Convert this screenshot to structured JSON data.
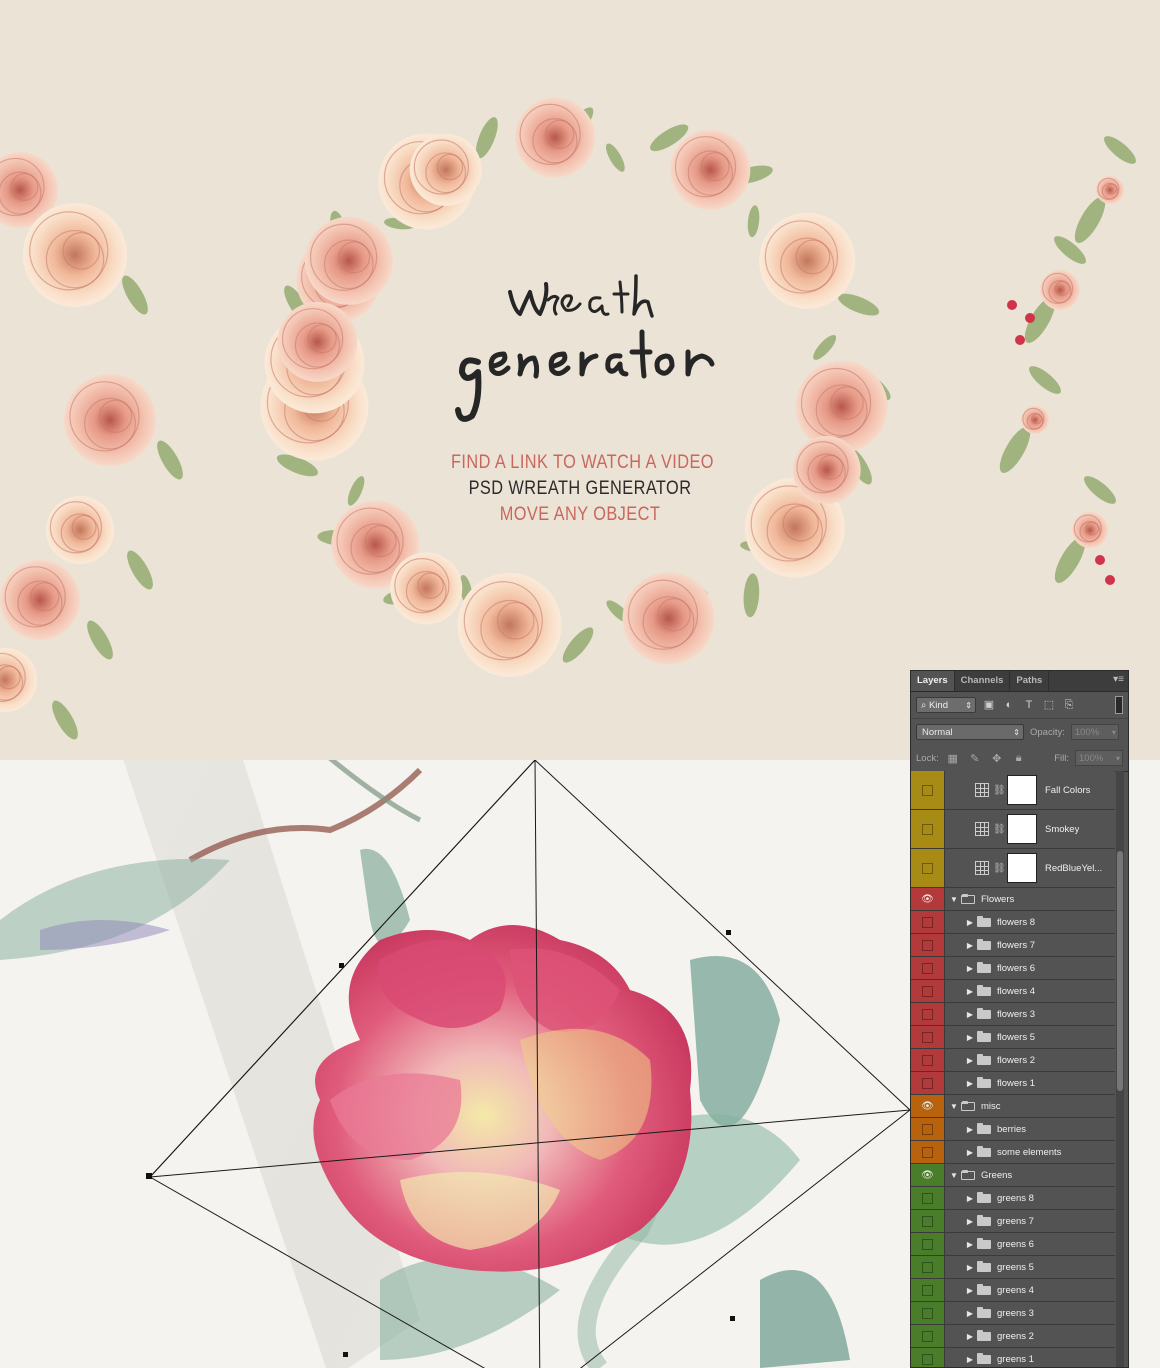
{
  "banner": {
    "lines": [
      "FIND A LINK TO WATCH A VIDEO",
      "PSD WREATH GENERATOR",
      "MOVE ANY OBJECT"
    ],
    "line_colors": [
      "#c9675c",
      "#2b2b2b",
      "#c9675c"
    ]
  },
  "panel": {
    "tabs": [
      "Layers",
      "Channels",
      "Paths"
    ],
    "filter_kind": "Kind",
    "blend_mode": "Normal",
    "opacity_label": "Opacity:",
    "opacity_value": "100%",
    "lock_label": "Lock:",
    "fill_label": "Fill:",
    "fill_value": "100%",
    "layers": [
      {
        "name": "Fall Colors",
        "type": "adjustment",
        "color": "#a88b14",
        "visible": false
      },
      {
        "name": "Smokey",
        "type": "adjustment",
        "color": "#a88b14",
        "visible": false
      },
      {
        "name": "RedBlueYel...",
        "type": "adjustment",
        "color": "#a88b14",
        "visible": false
      },
      {
        "name": "Flowers",
        "type": "group-open",
        "color": "#b33a3a",
        "visible": true
      },
      {
        "name": "flowers 8",
        "type": "group",
        "color": "#b33a3a",
        "visible": false
      },
      {
        "name": "flowers 7",
        "type": "group",
        "color": "#b33a3a",
        "visible": false
      },
      {
        "name": "flowers 6",
        "type": "group",
        "color": "#b33a3a",
        "visible": false
      },
      {
        "name": "flowers 4",
        "type": "group",
        "color": "#b33a3a",
        "visible": false
      },
      {
        "name": "flowers 3",
        "type": "group",
        "color": "#b33a3a",
        "visible": false
      },
      {
        "name": "flowers 5",
        "type": "group",
        "color": "#b33a3a",
        "visible": false
      },
      {
        "name": "flowers 2",
        "type": "group",
        "color": "#b33a3a",
        "visible": false
      },
      {
        "name": "flowers 1",
        "type": "group",
        "color": "#b33a3a",
        "visible": false
      },
      {
        "name": "misc",
        "type": "group-open",
        "color": "#b8620e",
        "visible": true
      },
      {
        "name": "berries",
        "type": "group",
        "color": "#b8620e",
        "visible": false
      },
      {
        "name": "some elements",
        "type": "group",
        "color": "#b8620e",
        "visible": false
      },
      {
        "name": "Greens",
        "type": "group-open",
        "color": "#4a7d2a",
        "visible": true
      },
      {
        "name": "greens 8",
        "type": "group",
        "color": "#4a7d2a",
        "visible": false
      },
      {
        "name": "greens 7",
        "type": "group",
        "color": "#4a7d2a",
        "visible": false
      },
      {
        "name": "greens 6",
        "type": "group",
        "color": "#4a7d2a",
        "visible": false
      },
      {
        "name": "greens 5",
        "type": "group",
        "color": "#4a7d2a",
        "visible": false
      },
      {
        "name": "greens 4",
        "type": "group",
        "color": "#4a7d2a",
        "visible": false
      },
      {
        "name": "greens 3",
        "type": "group",
        "color": "#4a7d2a",
        "visible": false
      },
      {
        "name": "greens 2",
        "type": "group",
        "color": "#4a7d2a",
        "visible": false
      },
      {
        "name": "greens 1",
        "type": "group",
        "color": "#4a7d2a",
        "visible": false
      }
    ]
  }
}
